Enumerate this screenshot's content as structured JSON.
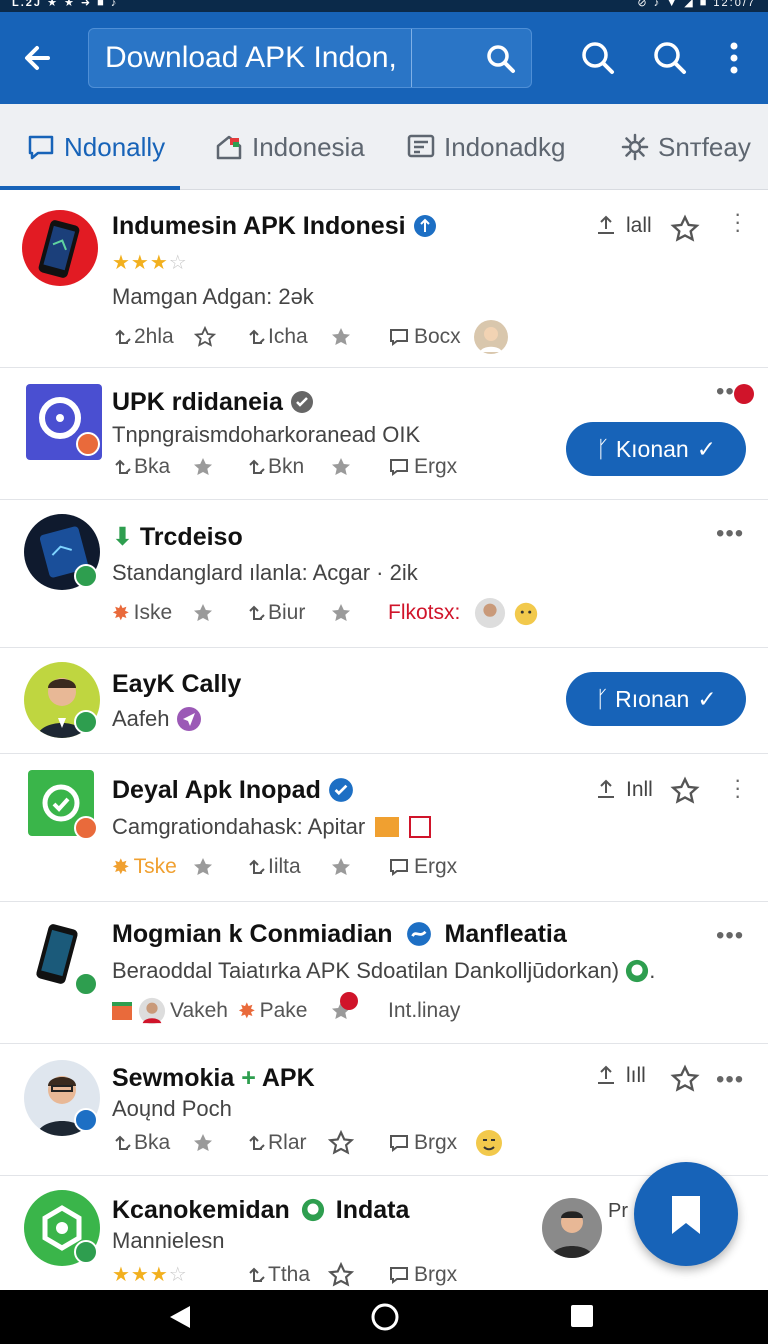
{
  "status_bar": {
    "left": "L.2J ★ ★ ➜ ■ ♪",
    "right": "⊘ ♪ ▼ ◢ ■ 12:0/7"
  },
  "app_bar": {
    "search_value": "Download APK Indon,"
  },
  "tabs": [
    {
      "label": "Ndonally",
      "icon": "chat-icon",
      "active": true
    },
    {
      "label": "Indonesia",
      "icon": "home-icon",
      "active": false
    },
    {
      "label": "Indonadkg",
      "icon": "list-icon",
      "active": false
    },
    {
      "label": "Snтfeay",
      "icon": "gear-icon",
      "active": false
    }
  ],
  "rows": [
    {
      "title": "Indumesin APK Indonesi",
      "rating": 3,
      "subtitle": "Mamgan Adgan: 2ǝk",
      "meta": [
        "2hla",
        "Icha",
        "Bocx"
      ],
      "action": "lall"
    },
    {
      "title": "UPK rdidaneia",
      "subtitle": "Tnpngraismdoharkoranead OIK",
      "meta": [
        "Bka",
        "Bkn",
        "Ergx"
      ],
      "button": "Kıonan"
    },
    {
      "title": "Trcdeiso",
      "subtitle": "Standanglard ılanla: Acgar · 2ik",
      "meta": [
        "Iske",
        "Biur",
        "Flkotsx:"
      ]
    },
    {
      "title": "EayK Cally",
      "subtitle": "Aafeh",
      "button": "Rıonan"
    },
    {
      "title": "Deyal Apk Inopad",
      "subtitle": "Camgrationdahask: Apitar",
      "meta": [
        "Tske",
        "Iilta",
        "Ergx"
      ],
      "action": "Inll"
    },
    {
      "title": "Mogmian k Conmiadian",
      "title2": "Manfleatia",
      "subtitle": "Beraoddal Taiatırka APK Sdoatilan Dankolljūdorkan)",
      "meta": [
        "Vakeh",
        "Pake",
        "Int.linay"
      ]
    },
    {
      "title": "Sewmokia",
      "title2": "APK",
      "subtitle": "Aoųnd Poch",
      "meta": [
        "Bka",
        "Rlar",
        "Brgx"
      ],
      "action": "lıll"
    },
    {
      "title": "Kcanokemidan",
      "title2": "Indata",
      "subtitle": "Mannielesn",
      "rating": 3,
      "meta": [
        "Ttha",
        "Brgx"
      ],
      "side_text": "Pr"
    }
  ],
  "colors": {
    "primary": "#1763b8",
    "accent_green": "#2e9e4f",
    "star": "#f2b01e",
    "alert_red": "#d0142a"
  }
}
